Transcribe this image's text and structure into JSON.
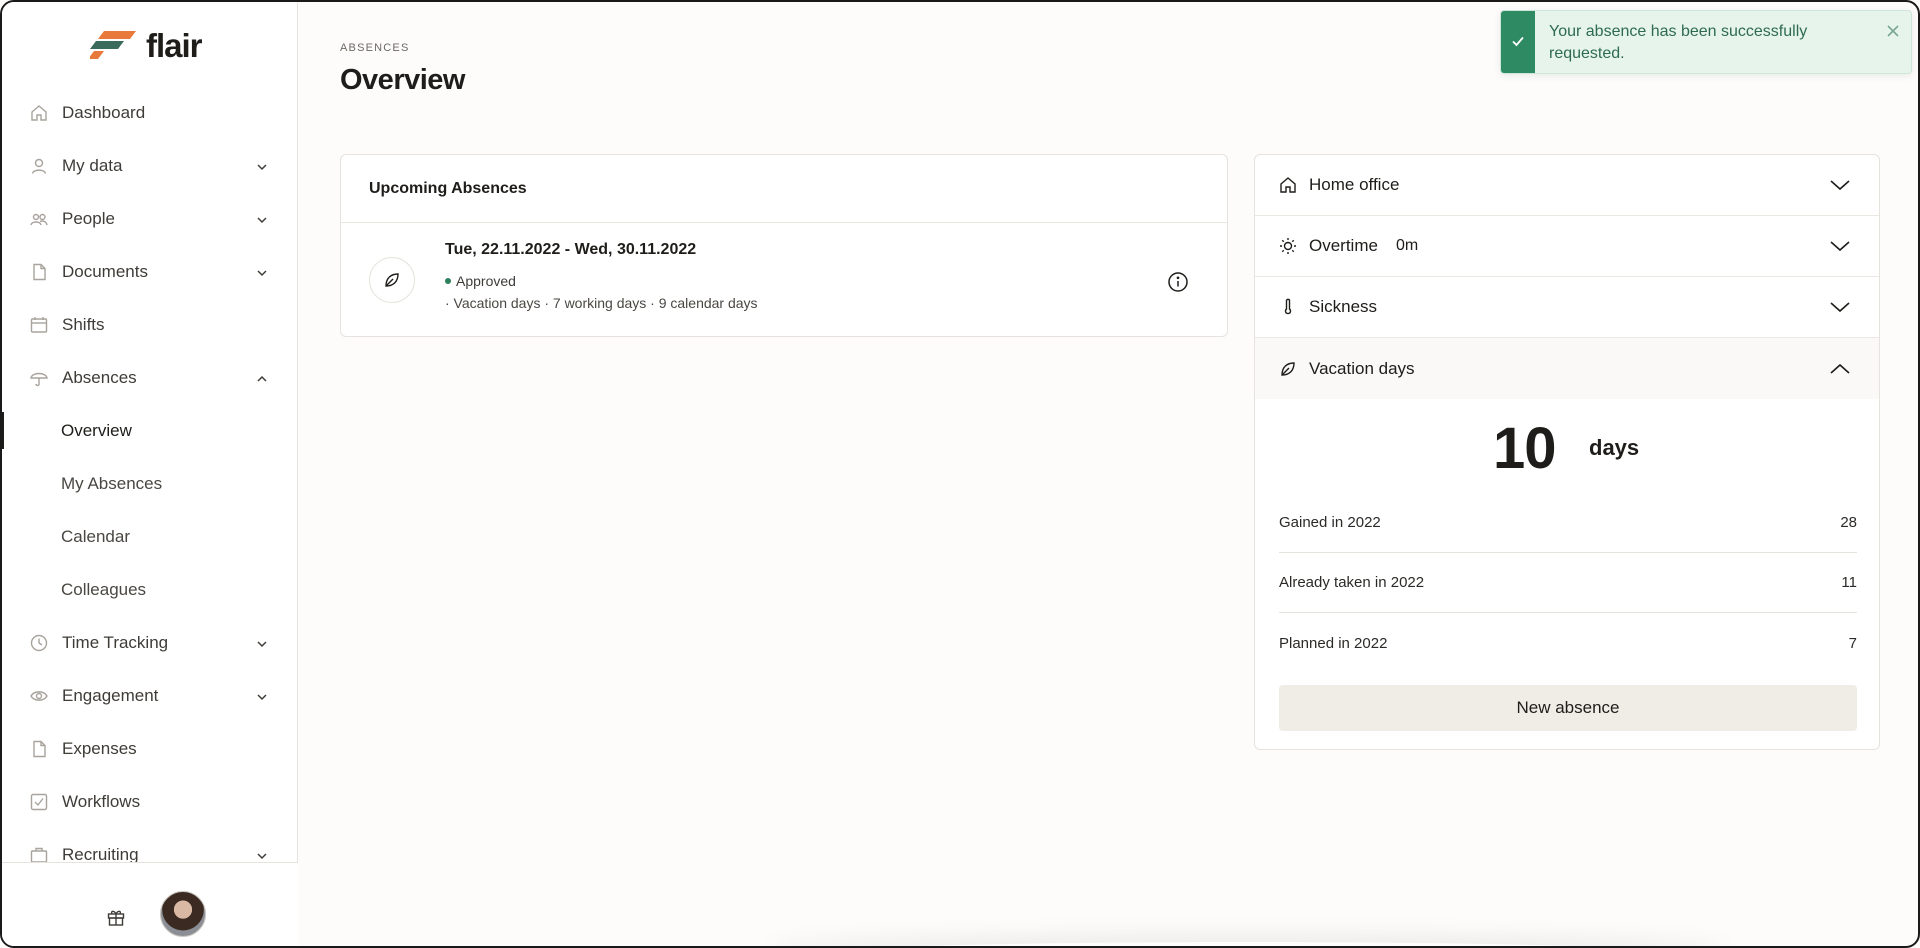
{
  "app": {
    "name": "flair"
  },
  "sidebar": {
    "items": [
      {
        "label": "Dashboard"
      },
      {
        "label": "My data"
      },
      {
        "label": "People"
      },
      {
        "label": "Documents"
      },
      {
        "label": "Shifts"
      },
      {
        "label": "Absences"
      },
      {
        "label": "Overview"
      },
      {
        "label": "My Absences"
      },
      {
        "label": "Calendar"
      },
      {
        "label": "Colleagues"
      },
      {
        "label": "Time Tracking"
      },
      {
        "label": "Engagement"
      },
      {
        "label": "Expenses"
      },
      {
        "label": "Workflows"
      },
      {
        "label": "Recruiting"
      }
    ]
  },
  "header": {
    "eyebrow": "ABSENCES",
    "title": "Overview"
  },
  "upcoming": {
    "title": "Upcoming Absences",
    "absence": {
      "dates": "Tue, 22.11.2022 - Wed, 30.11.2022",
      "status": "Approved",
      "meta": "· Vacation days · 7 working days · 9 calendar days"
    }
  },
  "categories": {
    "home_office": "Home office",
    "overtime": "Overtime",
    "overtime_value": "0m",
    "sickness": "Sickness",
    "vacation": "Vacation days"
  },
  "vacation": {
    "balance": "10",
    "unit": "days",
    "stats": [
      {
        "label": "Gained in 2022",
        "value": "28"
      },
      {
        "label": "Already taken in 2022",
        "value": "11"
      },
      {
        "label": "Planned in 2022",
        "value": "7"
      }
    ],
    "button": "New absence"
  },
  "toast": {
    "message": "Your absence has been successfully requested."
  },
  "colors": {
    "accent_orange": "#e8793a",
    "accent_green": "#2e8a63",
    "status_green": "#2e7d5b"
  }
}
